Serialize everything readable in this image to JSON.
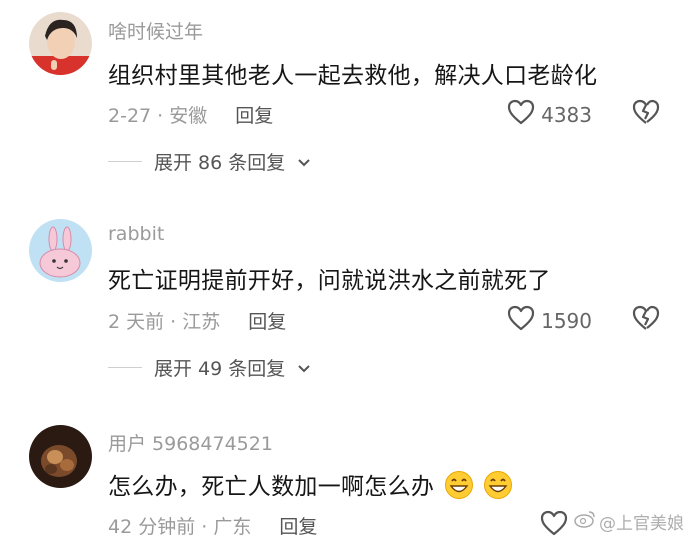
{
  "comments": [
    {
      "username": "啥时候过年",
      "content": "组织村里其他老人一起去救他，解决人口老龄化",
      "meta": "2-27 · 安徽",
      "reply_label": "回复",
      "likes": "4383",
      "expand_label": "展开 86 条回复"
    },
    {
      "username": "rabbit",
      "content": "死亡证明提前开好，问就说洪水之前就死了",
      "meta": "2 天前 · 江苏",
      "reply_label": "回复",
      "likes": "1590",
      "expand_label": "展开 49 条回复"
    },
    {
      "username": "用户 5968474521",
      "content": "怎么办，死亡人数加一啊怎么办",
      "meta": "42 分钟前 · 广东",
      "reply_label": "回复"
    }
  ],
  "watermark": "@上官美娘",
  "colors": {
    "secondary_text": "#9a9a9a",
    "primary_text": "#161616"
  }
}
